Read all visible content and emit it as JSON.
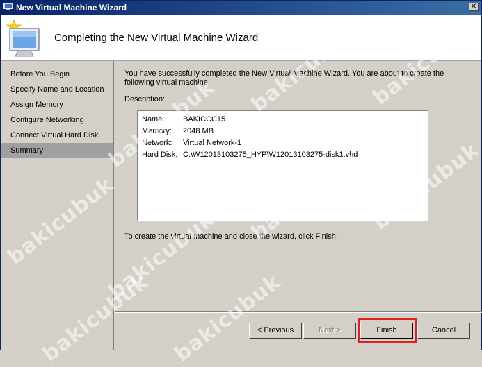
{
  "window": {
    "title": "New Virtual Machine Wizard",
    "close_glyph": "✕"
  },
  "header": {
    "title": "Completing the New Virtual Machine Wizard"
  },
  "sidebar": {
    "items": [
      {
        "label": "Before You Begin"
      },
      {
        "label": "Specify Name and Location"
      },
      {
        "label": "Assign Memory"
      },
      {
        "label": "Configure Networking"
      },
      {
        "label": "Connect Virtual Hard Disk"
      },
      {
        "label": "Summary",
        "selected": true
      }
    ]
  },
  "main": {
    "intro": "You have successfully completed the New Virtual Machine Wizard. You are about to create the following virtual machine.",
    "description_label": "Description:",
    "description": [
      {
        "key": "Name:",
        "value": "BAKICCC15"
      },
      {
        "key": "Memory:",
        "value": "2048 MB"
      },
      {
        "key": "Network:",
        "value": "Virtual Network-1"
      },
      {
        "key": "Hard Disk:",
        "value": "C:\\W12013103275_HYP\\W12013103275-disk1.vhd"
      }
    ],
    "finish_note": "To create the virtual machine and close the wizard, click Finish."
  },
  "buttons": {
    "previous": "< Previous",
    "next": "Next >",
    "finish": "Finish",
    "cancel": "Cancel"
  },
  "watermark": "bakicubuk",
  "colors": {
    "titlebar": "#0a246a",
    "selected_nav": "#a0a0a0",
    "highlight": "#e02020"
  }
}
